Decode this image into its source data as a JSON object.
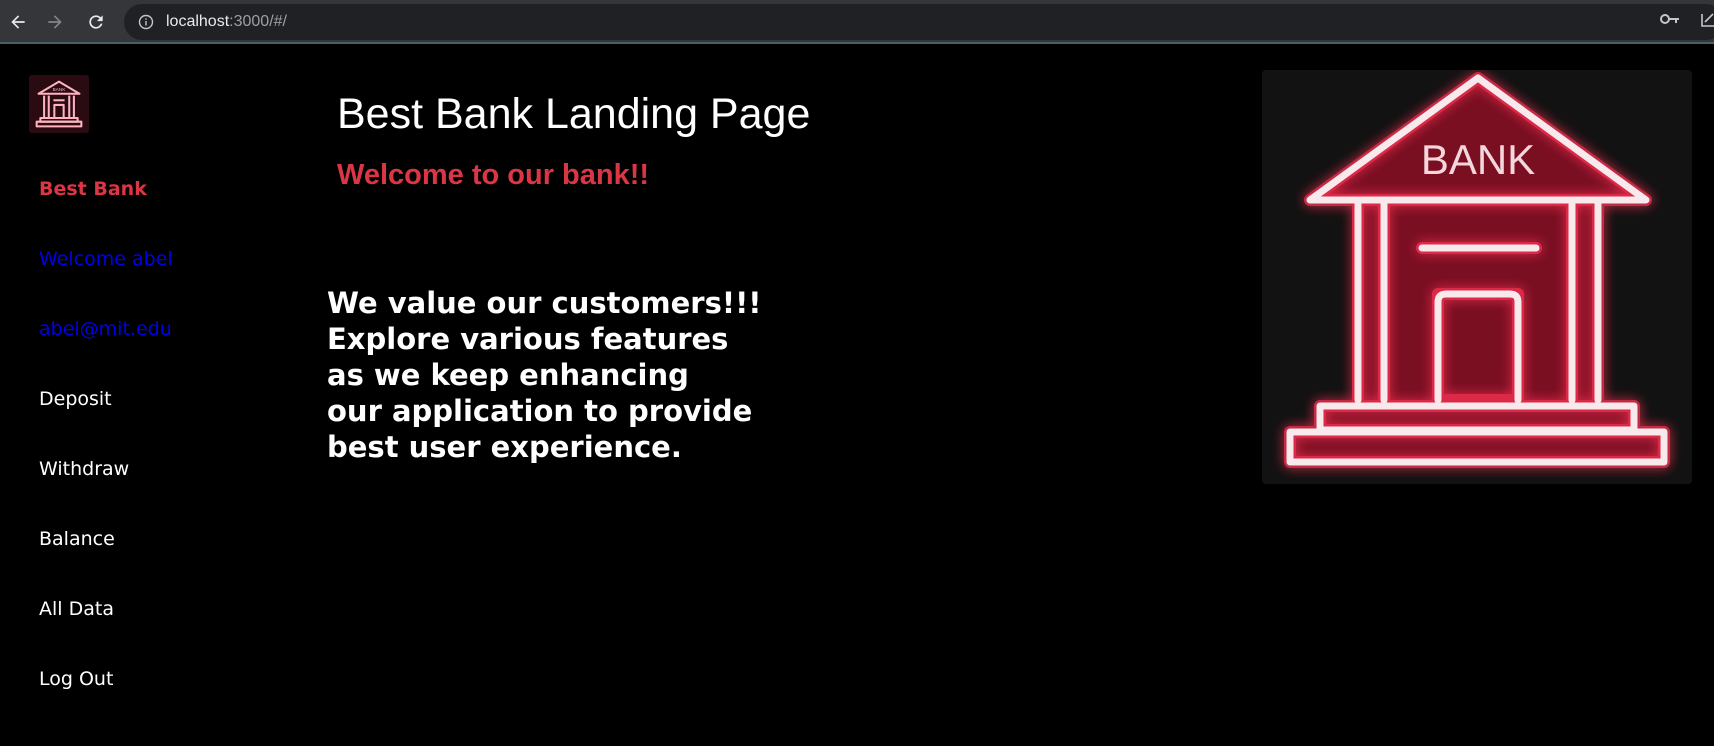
{
  "browser": {
    "url_host": "localhost",
    "url_rest": ":3000/#/",
    "back_icon": "arrow-left-icon",
    "forward_icon": "arrow-right-icon",
    "reload_icon": "reload-icon"
  },
  "sidebar": {
    "logo_text": "BANK",
    "brand": "Best Bank",
    "welcome": "Welcome abel",
    "email": "abel@mit.edu",
    "items": [
      {
        "label": "Deposit"
      },
      {
        "label": "Withdraw"
      },
      {
        "label": "Balance"
      },
      {
        "label": "All Data"
      },
      {
        "label": "Log Out"
      }
    ]
  },
  "main": {
    "title": "Best Bank Landing Page",
    "subtitle": "Welcome to our bank!!",
    "value_lines": [
      "We value our customers!!!",
      "Explore various features",
      "as we keep enhancing",
      "our application to provide",
      "best user experience."
    ],
    "hero_text": "BANK"
  },
  "colors": {
    "accent_red": "#dc3545",
    "link_blue": "#0000ee",
    "background": "#000000",
    "neon_red": "#c2102f"
  }
}
